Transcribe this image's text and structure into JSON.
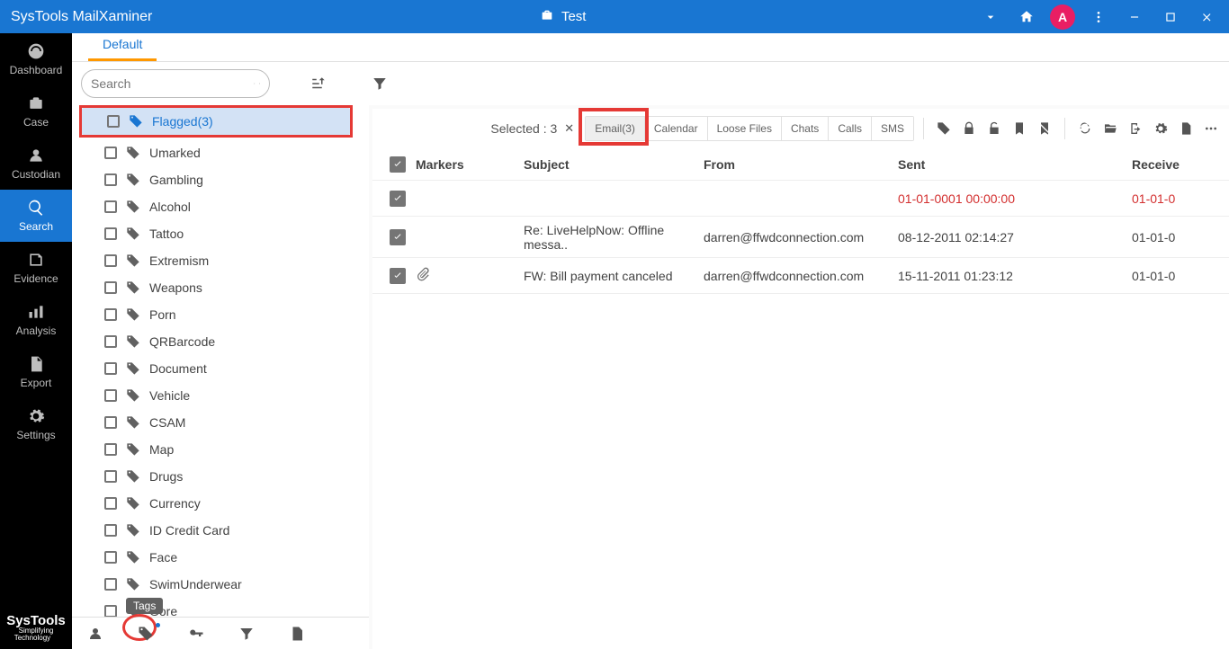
{
  "app": {
    "title": "SysTools MailXaminer",
    "case_name": "Test",
    "avatar": "A"
  },
  "leftnav": {
    "items": [
      {
        "label": "Dashboard"
      },
      {
        "label": "Case"
      },
      {
        "label": "Custodian"
      },
      {
        "label": "Search"
      },
      {
        "label": "Evidence"
      },
      {
        "label": "Analysis"
      },
      {
        "label": "Export"
      },
      {
        "label": "Settings"
      }
    ],
    "brand_big": "SysTools",
    "brand_small": "Simplifying Technology"
  },
  "tabs": {
    "default": "Default"
  },
  "search": {
    "placeholder": "Search"
  },
  "tags": [
    {
      "label": "Flagged(3)",
      "selected": true
    },
    {
      "label": "Umarked"
    },
    {
      "label": "Gambling"
    },
    {
      "label": "Alcohol"
    },
    {
      "label": "Tattoo"
    },
    {
      "label": "Extremism"
    },
    {
      "label": "Weapons"
    },
    {
      "label": "Porn"
    },
    {
      "label": "QRBarcode"
    },
    {
      "label": "Document"
    },
    {
      "label": "Vehicle"
    },
    {
      "label": "CSAM"
    },
    {
      "label": "Map"
    },
    {
      "label": "Drugs"
    },
    {
      "label": "Currency"
    },
    {
      "label": "ID Credit Card"
    },
    {
      "label": "Face"
    },
    {
      "label": "SwimUnderwear"
    },
    {
      "label": "Gore"
    }
  ],
  "tagtooltip": "Tags",
  "listtoolbar": {
    "selected_text": "Selected : 3",
    "categories": [
      "Email(3)",
      "Calendar",
      "Loose Files",
      "Chats",
      "Calls",
      "SMS"
    ]
  },
  "columns": {
    "markers": "Markers",
    "subject": "Subject",
    "from": "From",
    "sent": "Sent",
    "recv": "Receive"
  },
  "rows": [
    {
      "subject": "",
      "from": "",
      "sent": "01-01-0001 00:00:00",
      "recv": "01-01-0",
      "red": true,
      "attach": false
    },
    {
      "subject": "Re: LiveHelpNow: Offline messa..",
      "from": "darren@ffwdconnection.com",
      "sent": "08-12-2011 02:14:27",
      "recv": "01-01-0",
      "red": false,
      "attach": false
    },
    {
      "subject": "FW: Bill payment canceled",
      "from": "darren@ffwdconnection.com",
      "sent": "15-11-2011 01:23:12",
      "recv": "01-01-0",
      "red": false,
      "attach": true
    }
  ]
}
